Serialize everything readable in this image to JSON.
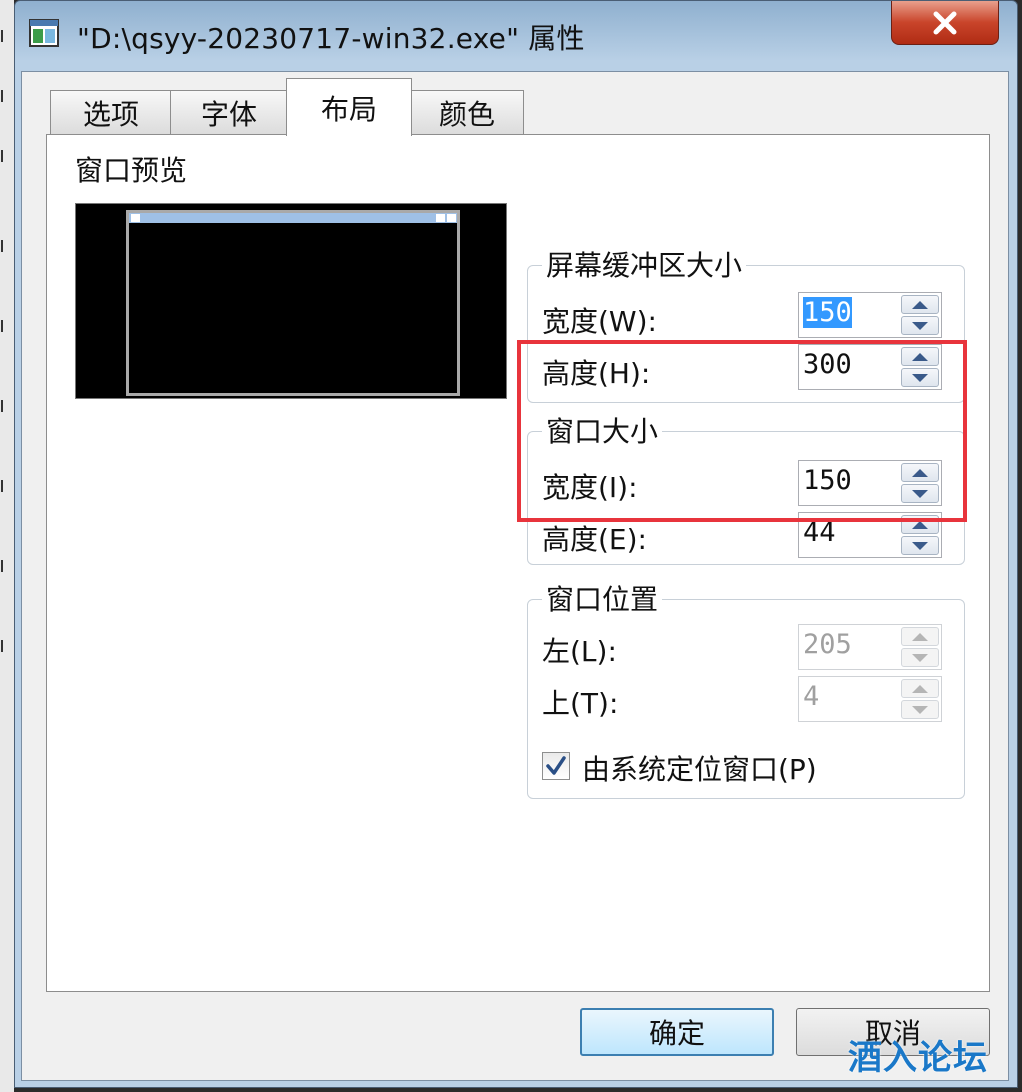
{
  "window": {
    "title": "\"D:\\qsyy-20230717-win32.exe\" 属性"
  },
  "tabs": [
    {
      "label": "选项",
      "active": false
    },
    {
      "label": "字体",
      "active": false
    },
    {
      "label": "布局",
      "active": true
    },
    {
      "label": "颜色",
      "active": false
    }
  ],
  "preview": {
    "label": "窗口预览"
  },
  "buffer_size": {
    "title": "屏幕缓冲区大小",
    "width_label": "宽度(W):",
    "width_value": "150",
    "height_label": "高度(H):",
    "height_value": "300"
  },
  "window_size": {
    "title": "窗口大小",
    "width_label": "宽度(I):",
    "width_value": "150",
    "height_label": "高度(E):",
    "height_value": "44"
  },
  "window_position": {
    "title": "窗口位置",
    "left_label": "左(L):",
    "left_value": "205",
    "top_label": "上(T):",
    "top_value": "4",
    "system_position_label": "由系统定位窗口(P)",
    "system_position_checked": true
  },
  "buttons": {
    "ok": "确定",
    "cancel": "取消"
  },
  "watermark": "酒入论坛",
  "colors": {
    "highlight": "#e8343c",
    "selection": "#3399ff"
  }
}
